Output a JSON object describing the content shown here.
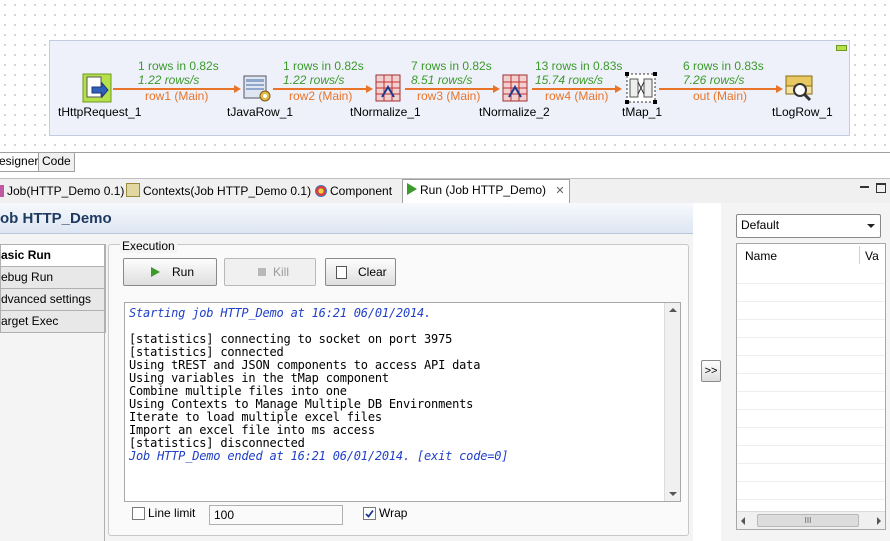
{
  "designer": {
    "components": [
      {
        "name": "tHttpRequest_1"
      },
      {
        "name": "tJavaRow_1"
      },
      {
        "name": "tNormalize_1"
      },
      {
        "name": "tNormalize_2"
      },
      {
        "name": "tMap_1"
      },
      {
        "name": "tLogRow_1"
      }
    ],
    "connections": [
      {
        "rows": "1 rows in 0.82s",
        "rate": "1.22 rows/s",
        "flow": "row1 (Main)"
      },
      {
        "rows": "1 rows in 0.82s",
        "rate": "1.22 rows/s",
        "flow": "row2 (Main)"
      },
      {
        "rows": "7 rows in 0.82s",
        "rate": "8.51 rows/s",
        "flow": "row3 (Main)"
      },
      {
        "rows": "13 rows in 0.83s",
        "rate": "15.74 rows/s",
        "flow": "row4 (Main)"
      },
      {
        "rows": "6 rows in 0.83s",
        "rate": "7.26 rows/s",
        "flow": "out (Main)"
      }
    ],
    "subtabs": {
      "designer": "esigner",
      "code": "Code"
    }
  },
  "editor_tabs": {
    "job": "Job(HTTP_Demo 0.1)",
    "contexts": "Contexts(Job HTTP_Demo 0.1)",
    "component": "Component",
    "run": "Run (Job HTTP_Demo)",
    "close": "✕"
  },
  "run_view": {
    "title": "ob HTTP_Demo",
    "menu": {
      "basic_run": "asic Run",
      "debug_run": "ebug Run",
      "advanced_settings": "dvanced settings",
      "target_exec": "arget Exec"
    },
    "execution_label": "Execution",
    "buttons": {
      "run": "Run",
      "kill": "Kill",
      "clear": "Clear"
    },
    "console_lines": [
      {
        "text": "Starting job HTTP_Demo at 16:21 06/01/2014.",
        "style": "blue"
      },
      {
        "text": "",
        "style": "normal"
      },
      {
        "text": "[statistics] connecting to socket on port 3975",
        "style": "normal"
      },
      {
        "text": "[statistics] connected",
        "style": "normal"
      },
      {
        "text": "Using tREST and JSON components to access API data",
        "style": "normal"
      },
      {
        "text": "Using variables in the tMap component",
        "style": "normal"
      },
      {
        "text": "Combine multiple files into one",
        "style": "normal"
      },
      {
        "text": "Using Contexts to Manage Multiple DB Environments",
        "style": "normal"
      },
      {
        "text": "Iterate to load multiple excel files",
        "style": "normal"
      },
      {
        "text": "Import an excel file into ms access",
        "style": "normal"
      },
      {
        "text": "[statistics] disconnected",
        "style": "normal"
      },
      {
        "text": "Job HTTP_Demo ended at 16:21 06/01/2014. [exit code=0]",
        "style": "blue"
      }
    ],
    "line_limit": {
      "label": "Line limit",
      "value": "100",
      "checked": false
    },
    "wrap": {
      "label": "Wrap",
      "checked": true
    },
    "expand_button": ">>"
  },
  "context_panel": {
    "selected": "Default",
    "columns": {
      "name": "Name",
      "value": "Va"
    },
    "scroll_thumb": "III"
  },
  "colors": {
    "connection": "#e8742a",
    "stats": "#3a9a2a",
    "console_blue": "#1f3fc8"
  }
}
